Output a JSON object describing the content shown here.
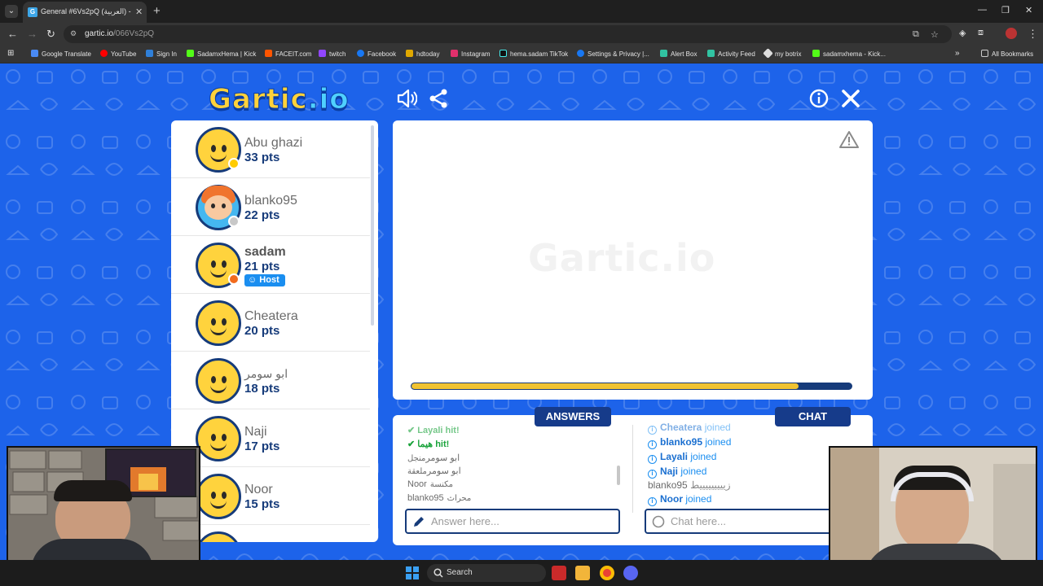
{
  "browser": {
    "tab_title": "General #6Vs2pQ (العربية) - Gartic",
    "url_host": "gartic.io",
    "url_path": "/066Vs2pQ",
    "bookmarks": [
      "Google Translate",
      "YouTube",
      "Sign In",
      "SadamxHema | Kick",
      "FACEIT.com",
      "twitch",
      "Facebook",
      "hdtoday",
      "Instagram",
      "hema.sadam TikTok",
      "Settings & Privacy |...",
      "Alert Box",
      "Activity Feed",
      "my botrix",
      "sadamxhema - Kick..."
    ],
    "all_bookmarks": "All Bookmarks"
  },
  "game": {
    "logo_part1": "Gartic",
    "logo_part2": ".io",
    "players": [
      {
        "name": "Abu ghazi",
        "points": "33 pts",
        "status_color": "#ffcc00",
        "avatar": "smiley-icon"
      },
      {
        "name": "blanko95",
        "points": "22 pts",
        "status_color": "#c8c8c8",
        "avatar": "boy-icon"
      },
      {
        "name": "sadam",
        "points": "21 pts",
        "status_color": "#f26b1d",
        "avatar": "smiley-icon",
        "badge": "Host"
      },
      {
        "name": "Cheatera",
        "points": "20 pts",
        "avatar": "smiley-icon"
      },
      {
        "name": "ابو سومر",
        "points": "18 pts",
        "avatar": "smiley-icon"
      },
      {
        "name": "Naji",
        "points": "17 pts",
        "avatar": "smiley-icon"
      },
      {
        "name": "Noor",
        "points": "15 pts",
        "avatar": "smiley-icon"
      }
    ],
    "canvas_watermark": "Gartic.io",
    "timer_progress": 0.88,
    "answers_label": "ANSWERS",
    "chat_label": "CHAT",
    "answers": [
      {
        "who": "Layali",
        "what": "hit!",
        "hit": true
      },
      {
        "who": "هيما",
        "what": "hit!",
        "hit": true
      },
      {
        "who": "ابو سومر",
        "what": "منجل"
      },
      {
        "who": "ابو سومر",
        "what": "ملعقة"
      },
      {
        "who": "Noor",
        "what": "مكنسة"
      },
      {
        "who": "blanko95",
        "what": "محراث"
      }
    ],
    "chat": [
      {
        "who": "Cheatera",
        "what": "joined",
        "system": true
      },
      {
        "who": "blanko95",
        "what": "joined",
        "system": true
      },
      {
        "who": "Layali",
        "what": "joined",
        "system": true
      },
      {
        "who": "Naji",
        "what": "joined",
        "system": true
      },
      {
        "who": "blanko95",
        "what": "زيييييييييط",
        "system": false
      },
      {
        "who": "Noor",
        "what": "joined",
        "system": true
      }
    ],
    "answer_placeholder": "Answer here...",
    "chat_placeholder": "Chat here..."
  },
  "taskbar": {
    "search_label": "Search"
  }
}
